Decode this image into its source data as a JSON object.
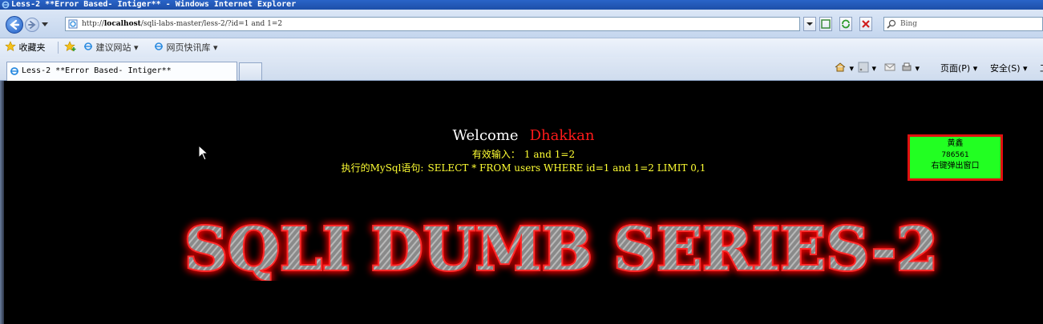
{
  "window": {
    "title": "Less-2 **Error Based- Intiger** - Windows Internet Explorer"
  },
  "address_bar": {
    "url_prefix": "http://",
    "url_host": "localhost",
    "url_path": "/sqli-labs-master/less-2/?id=1 and 1=2",
    "search_placeholder": "Bing"
  },
  "favorites_bar": {
    "favorites": "收藏夹",
    "suggested_sites": "建议网站 ▾",
    "web_slice_gallery": "网页快讯库 ▾"
  },
  "tabs": [
    {
      "label": "Less-2 **Error Based- Intiger**"
    }
  ],
  "command_bar": {
    "page": "页面(P) ▾",
    "safety": "安全(S) ▾",
    "tools_partial": "工"
  },
  "content": {
    "welcome": "Welcome",
    "name": "Dhakkan",
    "input_label": "有效输入：",
    "input_value": "1 and 1=2",
    "sql_label": "执行的MySql语句:",
    "sql_value": "SELECT * FROM users WHERE id=1 and 1=2 LIMIT 0,1",
    "banner_text": "SQLI DUMB SERIES-2",
    "greenbox": {
      "name": "黄鑫",
      "id": "786561",
      "hint": "右键弹出窗口"
    }
  },
  "colors": {
    "page_bg": "#000000",
    "welcome_text": "#ffffff",
    "name_text": "#ff1a1a",
    "sql_text": "#ffff33",
    "green_box": "#22ff22",
    "green_box_border": "#e01010"
  }
}
